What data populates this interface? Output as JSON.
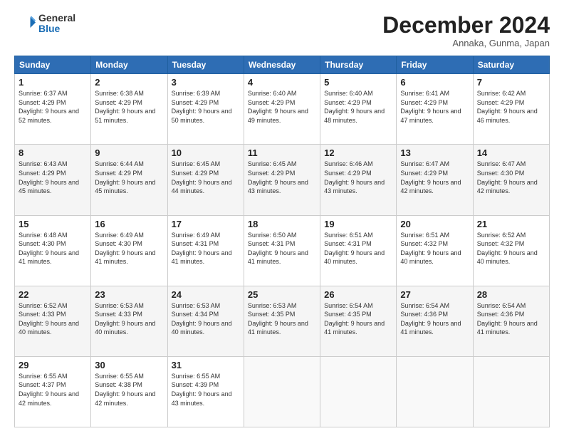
{
  "header": {
    "logo_general": "General",
    "logo_blue": "Blue",
    "month_title": "December 2024",
    "location": "Annaka, Gunma, Japan"
  },
  "weekdays": [
    "Sunday",
    "Monday",
    "Tuesday",
    "Wednesday",
    "Thursday",
    "Friday",
    "Saturday"
  ],
  "weeks": [
    [
      {
        "day": "1",
        "sunrise": "6:37 AM",
        "sunset": "4:29 PM",
        "daylight": "9 hours and 52 minutes."
      },
      {
        "day": "2",
        "sunrise": "6:38 AM",
        "sunset": "4:29 PM",
        "daylight": "9 hours and 51 minutes."
      },
      {
        "day": "3",
        "sunrise": "6:39 AM",
        "sunset": "4:29 PM",
        "daylight": "9 hours and 50 minutes."
      },
      {
        "day": "4",
        "sunrise": "6:40 AM",
        "sunset": "4:29 PM",
        "daylight": "9 hours and 49 minutes."
      },
      {
        "day": "5",
        "sunrise": "6:40 AM",
        "sunset": "4:29 PM",
        "daylight": "9 hours and 48 minutes."
      },
      {
        "day": "6",
        "sunrise": "6:41 AM",
        "sunset": "4:29 PM",
        "daylight": "9 hours and 47 minutes."
      },
      {
        "day": "7",
        "sunrise": "6:42 AM",
        "sunset": "4:29 PM",
        "daylight": "9 hours and 46 minutes."
      }
    ],
    [
      {
        "day": "8",
        "sunrise": "6:43 AM",
        "sunset": "4:29 PM",
        "daylight": "9 hours and 45 minutes."
      },
      {
        "day": "9",
        "sunrise": "6:44 AM",
        "sunset": "4:29 PM",
        "daylight": "9 hours and 45 minutes."
      },
      {
        "day": "10",
        "sunrise": "6:45 AM",
        "sunset": "4:29 PM",
        "daylight": "9 hours and 44 minutes."
      },
      {
        "day": "11",
        "sunrise": "6:45 AM",
        "sunset": "4:29 PM",
        "daylight": "9 hours and 43 minutes."
      },
      {
        "day": "12",
        "sunrise": "6:46 AM",
        "sunset": "4:29 PM",
        "daylight": "9 hours and 43 minutes."
      },
      {
        "day": "13",
        "sunrise": "6:47 AM",
        "sunset": "4:29 PM",
        "daylight": "9 hours and 42 minutes."
      },
      {
        "day": "14",
        "sunrise": "6:47 AM",
        "sunset": "4:30 PM",
        "daylight": "9 hours and 42 minutes."
      }
    ],
    [
      {
        "day": "15",
        "sunrise": "6:48 AM",
        "sunset": "4:30 PM",
        "daylight": "9 hours and 41 minutes."
      },
      {
        "day": "16",
        "sunrise": "6:49 AM",
        "sunset": "4:30 PM",
        "daylight": "9 hours and 41 minutes."
      },
      {
        "day": "17",
        "sunrise": "6:49 AM",
        "sunset": "4:31 PM",
        "daylight": "9 hours and 41 minutes."
      },
      {
        "day": "18",
        "sunrise": "6:50 AM",
        "sunset": "4:31 PM",
        "daylight": "9 hours and 41 minutes."
      },
      {
        "day": "19",
        "sunrise": "6:51 AM",
        "sunset": "4:31 PM",
        "daylight": "9 hours and 40 minutes."
      },
      {
        "day": "20",
        "sunrise": "6:51 AM",
        "sunset": "4:32 PM",
        "daylight": "9 hours and 40 minutes."
      },
      {
        "day": "21",
        "sunrise": "6:52 AM",
        "sunset": "4:32 PM",
        "daylight": "9 hours and 40 minutes."
      }
    ],
    [
      {
        "day": "22",
        "sunrise": "6:52 AM",
        "sunset": "4:33 PM",
        "daylight": "9 hours and 40 minutes."
      },
      {
        "day": "23",
        "sunrise": "6:53 AM",
        "sunset": "4:33 PM",
        "daylight": "9 hours and 40 minutes."
      },
      {
        "day": "24",
        "sunrise": "6:53 AM",
        "sunset": "4:34 PM",
        "daylight": "9 hours and 40 minutes."
      },
      {
        "day": "25",
        "sunrise": "6:53 AM",
        "sunset": "4:35 PM",
        "daylight": "9 hours and 41 minutes."
      },
      {
        "day": "26",
        "sunrise": "6:54 AM",
        "sunset": "4:35 PM",
        "daylight": "9 hours and 41 minutes."
      },
      {
        "day": "27",
        "sunrise": "6:54 AM",
        "sunset": "4:36 PM",
        "daylight": "9 hours and 41 minutes."
      },
      {
        "day": "28",
        "sunrise": "6:54 AM",
        "sunset": "4:36 PM",
        "daylight": "9 hours and 41 minutes."
      }
    ],
    [
      {
        "day": "29",
        "sunrise": "6:55 AM",
        "sunset": "4:37 PM",
        "daylight": "9 hours and 42 minutes."
      },
      {
        "day": "30",
        "sunrise": "6:55 AM",
        "sunset": "4:38 PM",
        "daylight": "9 hours and 42 minutes."
      },
      {
        "day": "31",
        "sunrise": "6:55 AM",
        "sunset": "4:39 PM",
        "daylight": "9 hours and 43 minutes."
      },
      null,
      null,
      null,
      null
    ]
  ]
}
